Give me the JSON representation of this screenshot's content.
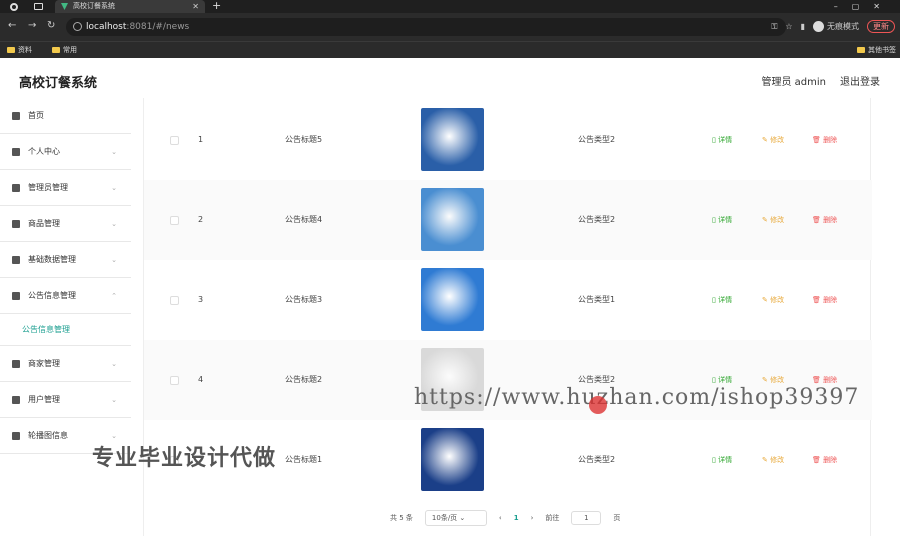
{
  "browser": {
    "tab_title": "高校订餐系统",
    "url_host": "localhost",
    "url_path": ":8081/#/news",
    "incognito_label": "无痕模式",
    "update_label": "更新",
    "bookmarks": [
      "资料",
      "常用"
    ],
    "bookmarks_right": "其他书签"
  },
  "header": {
    "app_title": "高校订餐系统",
    "user_label": "管理员 admin",
    "logout_label": "退出登录"
  },
  "sidebar": {
    "items": [
      {
        "label": "首页",
        "icon": "home-icon"
      },
      {
        "label": "个人中心",
        "icon": "user-icon"
      },
      {
        "label": "管理员管理",
        "icon": "list-icon"
      },
      {
        "label": "商品管理",
        "icon": "send-icon"
      },
      {
        "label": "基础数据管理",
        "icon": "phone-icon"
      },
      {
        "label": "公告信息管理",
        "icon": "chart-icon"
      }
    ],
    "active_sub": "公告信息管理",
    "items_after": [
      {
        "label": "商家管理",
        "icon": "location-icon"
      },
      {
        "label": "用户管理",
        "icon": "card-icon"
      },
      {
        "label": "轮播图信息",
        "icon": "gear-icon"
      }
    ]
  },
  "table": {
    "rows": [
      {
        "index": "1",
        "title": "公告标题5",
        "type": "公告类型2",
        "thumb_color": "#2a5fa8"
      },
      {
        "index": "2",
        "title": "公告标题4",
        "type": "公告类型2",
        "thumb_color": "#4a8ed1"
      },
      {
        "index": "3",
        "title": "公告标题3",
        "type": "公告类型1",
        "thumb_color": "#2f7bd3"
      },
      {
        "index": "4",
        "title": "公告标题2",
        "type": "公告类型2",
        "thumb_color": "#d9d9d9"
      },
      {
        "index": "",
        "title": "公告标题1",
        "type": "公告类型2",
        "thumb_color": "#1b3f88"
      }
    ],
    "detail_label": "详情",
    "edit_label": "修改",
    "delete_label": "删除"
  },
  "pager": {
    "total": "共 5 条",
    "page_size": "10条/页",
    "current": "1",
    "goto_label": "前往",
    "goto_value": "1",
    "page_unit": "页"
  },
  "overlay": {
    "promo_text": "专业毕业设计代做",
    "url_watermark": "https://www.huzhan.com/ishop39397"
  },
  "accent": "#1a9e8f"
}
